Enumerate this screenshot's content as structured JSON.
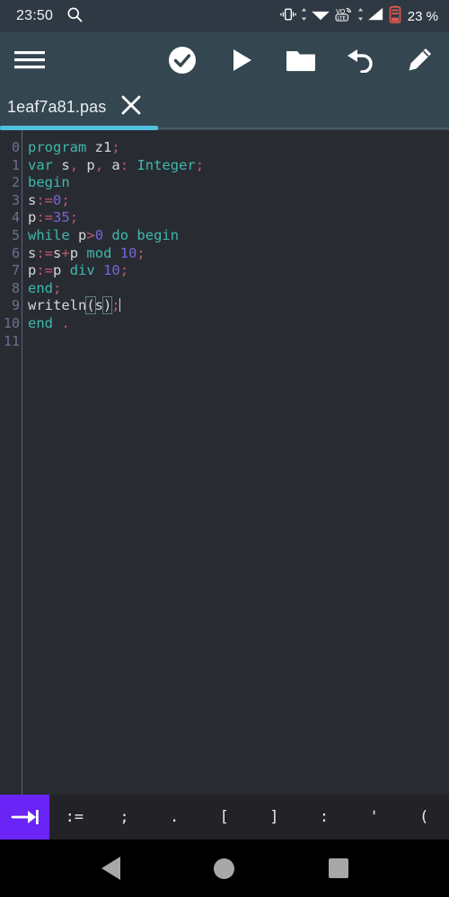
{
  "status_bar": {
    "time": "23:50",
    "battery_text": "23 %",
    "icons": [
      "search-icon",
      "vibrate-icon",
      "wifi-icon",
      "volte-icon",
      "signal-icon",
      "battery-icon"
    ]
  },
  "toolbar": {
    "menu_icon": "hamburger-menu-icon",
    "actions": [
      {
        "name": "check-circle-icon",
        "label": "Check"
      },
      {
        "name": "play-icon",
        "label": "Run"
      },
      {
        "name": "folder-icon",
        "label": "Open"
      },
      {
        "name": "undo-icon",
        "label": "Undo"
      },
      {
        "name": "pencil-icon",
        "label": "Edit"
      }
    ]
  },
  "tab": {
    "filename": "1eaf7a81.pas",
    "close_icon": "close-icon",
    "accent_color": "#4ec3e0"
  },
  "editor": {
    "language": "pascal",
    "background": "#282c32",
    "lines": [
      {
        "n": "0",
        "tokens": [
          {
            "t": "program",
            "c": "kw"
          },
          {
            "t": " ",
            "c": "id"
          },
          {
            "t": "z1",
            "c": "id"
          },
          {
            "t": ";",
            "c": "pun"
          }
        ]
      },
      {
        "n": "1",
        "tokens": [
          {
            "t": "var",
            "c": "kw"
          },
          {
            "t": " ",
            "c": "id"
          },
          {
            "t": "s",
            "c": "id"
          },
          {
            "t": ",",
            "c": "pun"
          },
          {
            "t": " ",
            "c": "id"
          },
          {
            "t": "p",
            "c": "id"
          },
          {
            "t": ",",
            "c": "pun"
          },
          {
            "t": " ",
            "c": "id"
          },
          {
            "t": "a",
            "c": "id"
          },
          {
            "t": ":",
            "c": "pun"
          },
          {
            "t": " ",
            "c": "id"
          },
          {
            "t": "Integer",
            "c": "kw"
          },
          {
            "t": ";",
            "c": "pun"
          }
        ]
      },
      {
        "n": "2",
        "tokens": [
          {
            "t": "begin",
            "c": "kw"
          }
        ]
      },
      {
        "n": "3",
        "tokens": [
          {
            "t": "s",
            "c": "id"
          },
          {
            "t": ":",
            "c": "pun"
          },
          {
            "t": "=",
            "c": "op"
          },
          {
            "t": "0",
            "c": "num"
          },
          {
            "t": ";",
            "c": "pun"
          }
        ]
      },
      {
        "n": "4",
        "tokens": [
          {
            "t": "p",
            "c": "id"
          },
          {
            "t": ":",
            "c": "pun"
          },
          {
            "t": "=",
            "c": "op"
          },
          {
            "t": "35",
            "c": "num"
          },
          {
            "t": ";",
            "c": "pun"
          }
        ]
      },
      {
        "n": "5",
        "tokens": [
          {
            "t": "while",
            "c": "kw"
          },
          {
            "t": " ",
            "c": "id"
          },
          {
            "t": "p",
            "c": "id"
          },
          {
            "t": ">",
            "c": "op"
          },
          {
            "t": "0",
            "c": "num"
          },
          {
            "t": " ",
            "c": "id"
          },
          {
            "t": "do",
            "c": "kw"
          },
          {
            "t": " ",
            "c": "id"
          },
          {
            "t": "begin",
            "c": "kw"
          }
        ]
      },
      {
        "n": "6",
        "tokens": [
          {
            "t": "s",
            "c": "id"
          },
          {
            "t": ":",
            "c": "pun"
          },
          {
            "t": "=",
            "c": "op"
          },
          {
            "t": "s",
            "c": "id"
          },
          {
            "t": "+",
            "c": "op"
          },
          {
            "t": "p",
            "c": "id"
          },
          {
            "t": " ",
            "c": "id"
          },
          {
            "t": "mod",
            "c": "kw"
          },
          {
            "t": " ",
            "c": "id"
          },
          {
            "t": "10",
            "c": "num"
          },
          {
            "t": ";",
            "c": "pun"
          }
        ]
      },
      {
        "n": "7",
        "tokens": [
          {
            "t": "p",
            "c": "id"
          },
          {
            "t": ":",
            "c": "pun"
          },
          {
            "t": "=",
            "c": "op"
          },
          {
            "t": "p",
            "c": "id"
          },
          {
            "t": " ",
            "c": "id"
          },
          {
            "t": "div",
            "c": "kw"
          },
          {
            "t": " ",
            "c": "id"
          },
          {
            "t": "10",
            "c": "num"
          },
          {
            "t": ";",
            "c": "pun"
          }
        ]
      },
      {
        "n": "8",
        "tokens": [
          {
            "t": "end",
            "c": "kw"
          },
          {
            "t": ";",
            "c": "pun"
          }
        ]
      },
      {
        "n": "9",
        "tokens": [
          {
            "t": "writeln",
            "c": "id"
          },
          {
            "t": "(",
            "c": "brk"
          },
          {
            "t": "s",
            "c": "id"
          },
          {
            "t": ")",
            "c": "brk"
          },
          {
            "t": ";",
            "c": "pun"
          }
        ]
      },
      {
        "n": "10",
        "tokens": [
          {
            "t": "end",
            "c": "kw"
          },
          {
            "t": " ",
            "c": "id"
          },
          {
            "t": ".",
            "c": "pun"
          }
        ]
      },
      {
        "n": "11",
        "tokens": []
      }
    ]
  },
  "symbol_bar": {
    "tab_key_icon": "tab-key-icon",
    "tab_key_color": "#6a24f5",
    "symbols": [
      ":=",
      ";",
      ".",
      "[",
      "]",
      ":",
      "'",
      "("
    ]
  },
  "nav_bar": {
    "buttons": [
      {
        "name": "nav-back-button",
        "label": "Back"
      },
      {
        "name": "nav-home-button",
        "label": "Home"
      },
      {
        "name": "nav-recents-button",
        "label": "Recents"
      }
    ]
  }
}
